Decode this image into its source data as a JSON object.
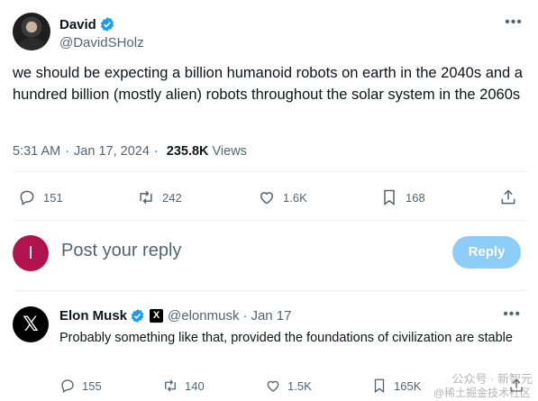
{
  "tweet": {
    "author": {
      "display_name": "David",
      "handle": "@DavidSHolz",
      "verified": true
    },
    "text": "we should be expecting a billion humanoid robots on earth in the 2040s and a hundred billion (mostly alien) robots throughout the solar system in the 2060s",
    "time": "5:31 AM",
    "date": "Jan 17, 2024",
    "views_count": "235.8K",
    "views_label": "Views",
    "stats": {
      "replies": "151",
      "retweets": "242",
      "likes": "1.6K",
      "bookmarks": "168"
    }
  },
  "reply_composer": {
    "avatar_letter": "I",
    "placeholder": "Post your reply",
    "button_label": "Reply",
    "button_color": "#8ecdf8",
    "avatar_color": "#b0134d"
  },
  "reply": {
    "author": {
      "display_name": "Elon Musk",
      "handle": "@elonmusk",
      "verified": true,
      "affiliate_badge": "X"
    },
    "date": "Jan 17",
    "text": "Probably something like that, provided the foundations of civilization are stable",
    "stats": {
      "replies": "155",
      "retweets": "140",
      "likes": "1.5K",
      "bookmarks": "165K"
    }
  },
  "watermark": {
    "line1": "公众号 · 新智元",
    "line2": "@稀土掘金技术社区"
  },
  "icons": {
    "verified": "verified-badge-icon",
    "more": "more-dots-icon",
    "reply": "reply-bubble-icon",
    "retweet": "retweet-icon",
    "like": "heart-icon",
    "bookmark": "bookmark-icon",
    "share": "share-icon"
  },
  "colors": {
    "accent": "#1d9bf0",
    "text": "#0f1419",
    "secondary": "#536471"
  }
}
